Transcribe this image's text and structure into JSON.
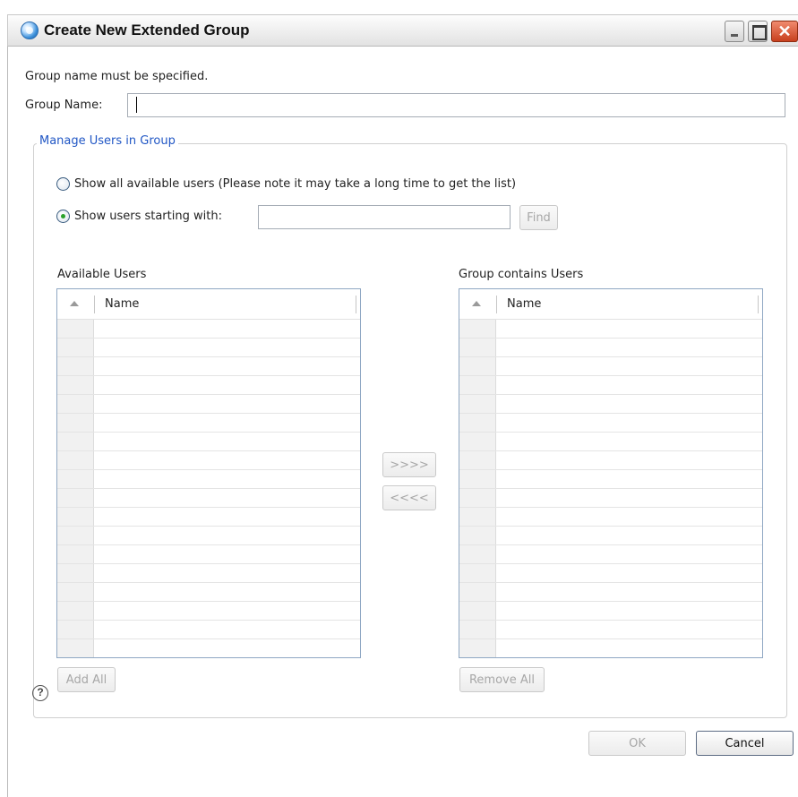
{
  "window": {
    "title": "Create New Extended Group",
    "controls": {
      "minimize": "minimize",
      "maximize": "maximize",
      "close": "✕"
    }
  },
  "form": {
    "message": "Group name must be specified.",
    "group_name_label": "Group Name:",
    "group_name_value": ""
  },
  "manage": {
    "legend": "Manage Users in Group",
    "radio_all_label": "Show all available users (Please note it may take a long time to get the list)",
    "radio_starting_label": "Show users starting with:",
    "selected_radio": "starting_with",
    "filter_value": "",
    "find_label": "Find"
  },
  "available": {
    "title": "Available Users",
    "column": "Name",
    "rows": [],
    "add_all_label": "Add All"
  },
  "transfer": {
    "add_label": ">>>>",
    "remove_label": "<<<<"
  },
  "group": {
    "title": "Group contains Users",
    "column": "Name",
    "rows": [],
    "remove_all_label": "Remove All"
  },
  "footer": {
    "help_icon": "?",
    "ok_label": "OK",
    "cancel_label": "Cancel"
  },
  "colors": {
    "legend": "#2157c5",
    "close_button": "#c8401e",
    "radio_selected": "#2aa12a"
  }
}
